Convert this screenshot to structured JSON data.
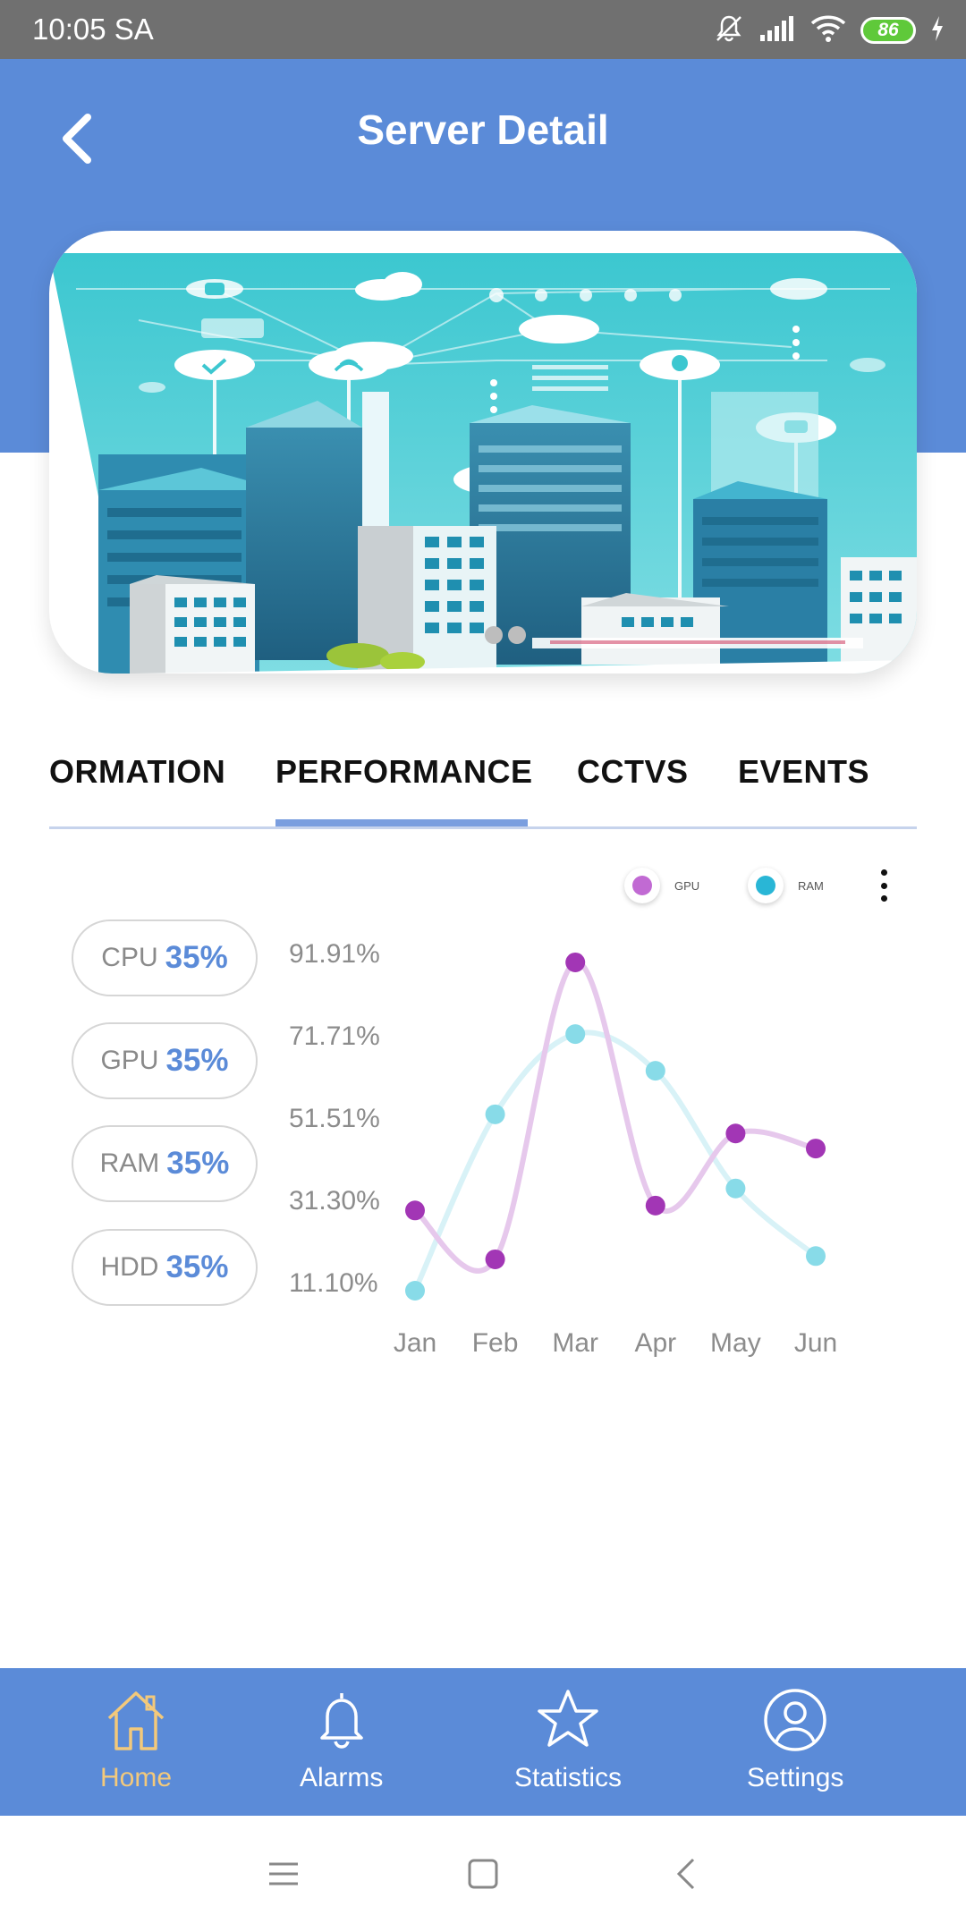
{
  "status_bar": {
    "time": "10:05 SA",
    "battery": "86"
  },
  "header": {
    "title": "Server Detail"
  },
  "tabs": [
    {
      "label": "ORMATION"
    },
    {
      "label": "PERFORMANCE",
      "active": true
    },
    {
      "label": "CCTVS"
    },
    {
      "label": "EVENTS"
    }
  ],
  "metrics": [
    {
      "label": "CPU",
      "value": "35%"
    },
    {
      "label": "GPU",
      "value": "35%"
    },
    {
      "label": "RAM",
      "value": "35%"
    },
    {
      "label": "HDD",
      "value": "35%"
    }
  ],
  "chart_data": {
    "type": "line",
    "categories": [
      "Jan",
      "Feb",
      "Mar",
      "Apr",
      "May",
      "Jun"
    ],
    "y_ticks": [
      "91.91%",
      "71.71%",
      "51.51%",
      "31.30%",
      "11.10%"
    ],
    "ylim": [
      11.1,
      91.91
    ],
    "series": [
      {
        "name": "GPU",
        "color": "#a236b5",
        "line_color": "#e6c8ec",
        "legend_color": "#c16ad3",
        "values": [
          28.6,
          16.6,
          89.5,
          29.8,
          47.5,
          43.8
        ]
      },
      {
        "name": "RAM",
        "color": "#88dbe8",
        "line_color": "#d8f2f7",
        "legend_color": "#29b6d6",
        "values": [
          8.9,
          52.2,
          71.9,
          62.9,
          34.0,
          17.4
        ]
      }
    ],
    "legend_position": "top-right",
    "grid": false
  },
  "bottom_nav": [
    {
      "label": "Home",
      "icon": "home-icon",
      "active": true
    },
    {
      "label": "Alarms",
      "icon": "bell-icon"
    },
    {
      "label": "Statistics",
      "icon": "star-icon"
    },
    {
      "label": "Settings",
      "icon": "user-icon"
    }
  ],
  "colors": {
    "primary": "#5b8bd8",
    "active_nav": "#f3c97b",
    "metric_value": "#5b8bd8"
  }
}
